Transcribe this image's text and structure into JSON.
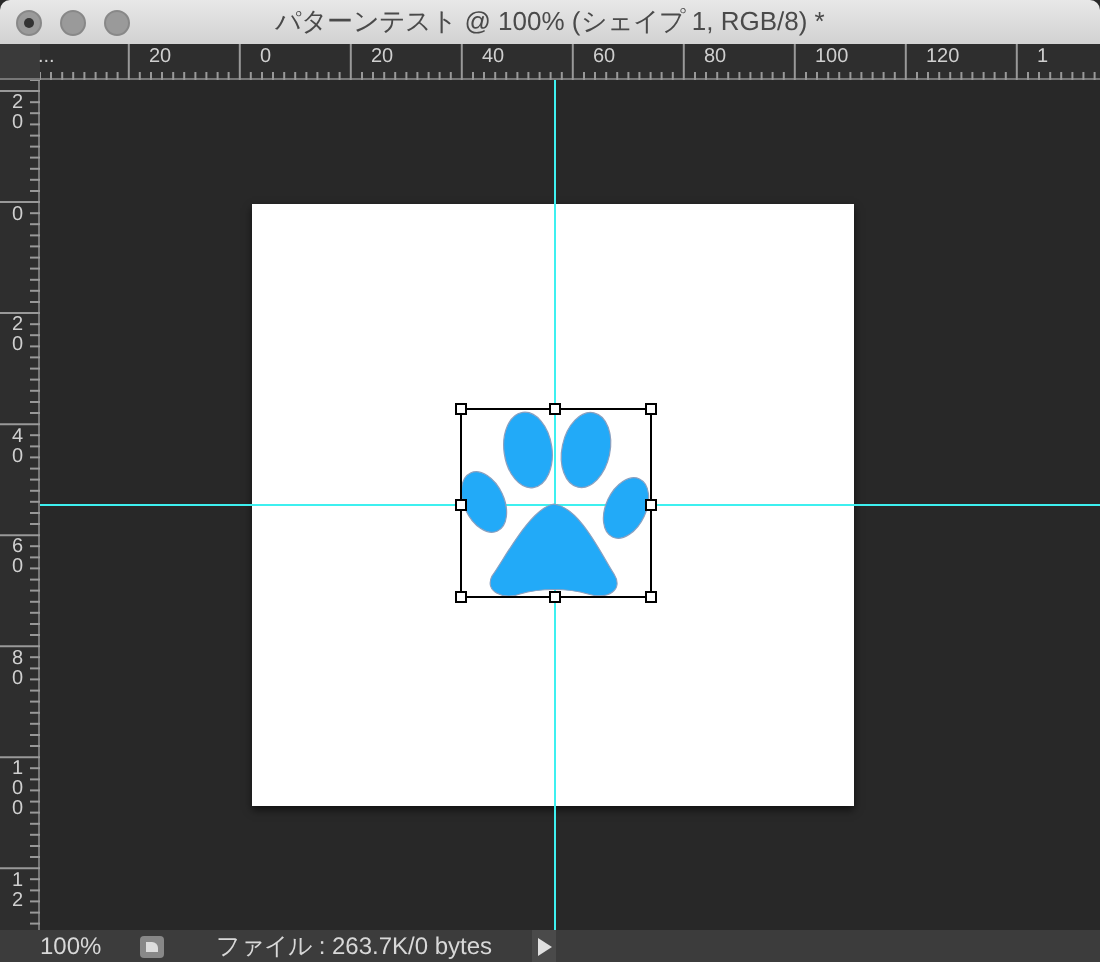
{
  "window": {
    "title": "パターンテスト @ 100% (シェイプ 1, RGB/8) *"
  },
  "horizontal_ruler": {
    "labels": [
      "...",
      "20",
      "0",
      "20",
      "40",
      "60",
      "80",
      "100",
      "120",
      "1"
    ]
  },
  "vertical_ruler": {
    "labels": [
      "20",
      "0",
      "20",
      "40",
      "60",
      "80",
      "100",
      "12"
    ]
  },
  "status_bar": {
    "zoom": "100%",
    "info": "ファイル : 263.7K/0 bytes"
  }
}
